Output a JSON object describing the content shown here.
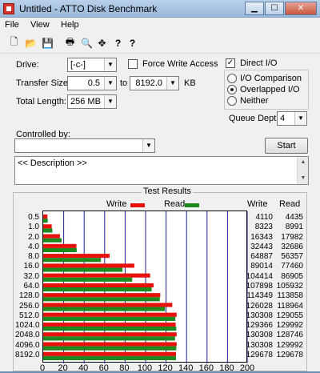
{
  "window": {
    "title": "Untitled - ATTO Disk Benchmark"
  },
  "menu": [
    "File",
    "View",
    "Help"
  ],
  "toolbar": [
    {
      "icon": "new-icon",
      "glyph": "🗋"
    },
    {
      "icon": "open-icon",
      "glyph": "📂"
    },
    {
      "icon": "save-icon",
      "glyph": "💾"
    },
    {
      "icon": "print-icon",
      "glyph": "🖶"
    },
    {
      "icon": "print-preview-icon",
      "glyph": "🔍"
    },
    {
      "icon": "move-icon",
      "glyph": "✥"
    },
    {
      "icon": "help-icon",
      "glyph": "?"
    },
    {
      "icon": "context-help-icon",
      "glyph": "?"
    }
  ],
  "settings": {
    "drive_label": "Drive:",
    "drive_value": "[-c-]",
    "force_write_label": "Force Write Access",
    "direct_io_label": "Direct I/O",
    "transfer_size_label": "Transfer Size:",
    "transfer_from": "0.5",
    "to_label": "to",
    "transfer_to": "8192.0",
    "kb_label": "KB",
    "total_length_label": "Total Length:",
    "total_length_value": "256 MB",
    "io_comparison_label": "I/O Comparison",
    "overlapped_io_label": "Overlapped I/O",
    "neither_label": "Neither",
    "queue_depth_label": "Queue Depth:",
    "queue_depth_value": "4",
    "controlled_by_label": "Controlled by:",
    "controlled_by_value": "",
    "start_label": "Start",
    "description": "<< Description >>"
  },
  "results": {
    "title": "Test Results",
    "write_label": "Write",
    "read_label": "Read",
    "write_col": "Write",
    "read_col": "Read"
  },
  "colors": {
    "write": "#e8120c",
    "read": "#1d8a1f"
  },
  "chart_data": {
    "type": "bar",
    "orientation": "horizontal",
    "title": "Test Results",
    "categories": [
      "0.5",
      "1.0",
      "2.0",
      "4.0",
      "8.0",
      "16.0",
      "32.0",
      "64.0",
      "128.0",
      "256.0",
      "512.0",
      "1024.0",
      "2048.0",
      "4096.0",
      "8192.0"
    ],
    "series": [
      {
        "name": "Write",
        "values": [
          4110,
          8323,
          16343,
          32443,
          64887,
          89014,
          104414,
          107898,
          114349,
          126028,
          130308,
          129366,
          130308,
          130308,
          129678
        ]
      },
      {
        "name": "Read",
        "values": [
          4435,
          8991,
          17982,
          32686,
          56357,
          77460,
          86905,
          105932,
          113858,
          118964,
          129055,
          129992,
          128746,
          129992,
          129678
        ]
      }
    ],
    "xticks": [
      "0",
      "20",
      "40",
      "60",
      "80",
      "100",
      "120",
      "140",
      "160",
      "180",
      "200"
    ],
    "xlim": [
      0,
      200
    ]
  }
}
